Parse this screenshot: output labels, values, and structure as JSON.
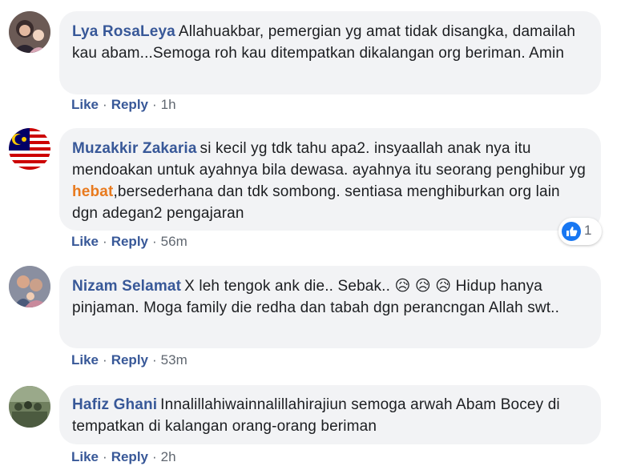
{
  "comments": [
    {
      "author": "Lya RosaLeya",
      "text": "Allahuakbar, pemergian yg amat tidak disangka, damailah kau abam...Semoga roh kau ditempatkan dikalangan org beriman. Amin",
      "like": "Like",
      "reply": "Reply",
      "time": "1h",
      "avatar_icon": "profile-photo-woman-hijab"
    },
    {
      "author": "Muzakkir Zakaria",
      "text_before": "si kecil yg tdk tahu apa2. insyaallah anak nya itu mendoakan untuk ayahnya bila dewasa. ayahnya itu seorang penghibur yg ",
      "text_highlight": "hebat",
      "text_after": ",bersederhana dan tdk sombong. sentiasa menghiburkan org lain dgn adegan2 pengajaran",
      "like": "Like",
      "reply": "Reply",
      "time": "56m",
      "avatar_icon": "malaysia-flag-icon",
      "reaction_count": "1",
      "reaction_icon": "thumbs-up-icon"
    },
    {
      "author": "Nizam Selamat",
      "text_before": "X leh tengok ank die.. Sebak.. ",
      "emojis": [
        "😥",
        "😥",
        "😥"
      ],
      "text_after": " Hidup hanya pinjaman. Moga family die redha dan tabah dgn perancngan Allah swt..",
      "like": "Like",
      "reply": "Reply",
      "time": "53m",
      "avatar_icon": "profile-photo-family"
    },
    {
      "author": "Hafiz Ghani",
      "text": "Innalillahiwainnalillahirajiun semoga arwah Abam Bocey di tempatkan di kalangan orang-orang beriman",
      "like": "Like",
      "reply": "Reply",
      "time": "2h",
      "avatar_icon": "profile-photo-group"
    }
  ],
  "colors": {
    "author": "#385898",
    "bubble": "#f2f3f5",
    "highlight": "#e87a1e",
    "meta": "#606770",
    "like_blue": "#1877f2"
  }
}
